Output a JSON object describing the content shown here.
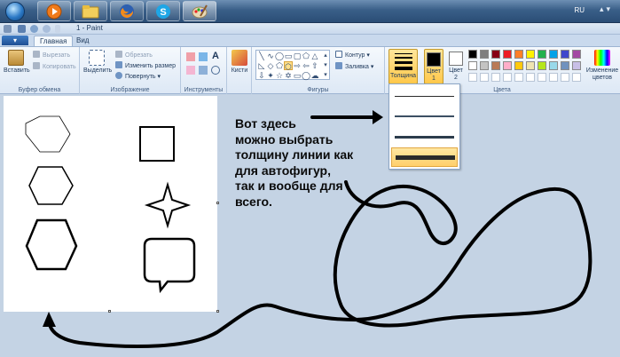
{
  "taskbar": {
    "apps": [
      {
        "name": "start-button"
      },
      {
        "name": "media-player"
      },
      {
        "name": "file-explorer"
      },
      {
        "name": "firefox"
      },
      {
        "name": "skype"
      },
      {
        "name": "paint"
      }
    ],
    "language": "RU"
  },
  "window": {
    "title": "1 - Paint"
  },
  "tabs": {
    "menu": "▾",
    "home": "Главная",
    "view": "Вид"
  },
  "ribbon": {
    "clipboard": {
      "paste": "Вставить",
      "cut": "Вырезать",
      "copy": "Копировать",
      "label": "Буфер обмена"
    },
    "image": {
      "select": "Выделить",
      "crop": "Обрезать",
      "resize": "Изменить размер",
      "rotate": "Повернуть",
      "label": "Изображение"
    },
    "tools": {
      "label": "Инструменты",
      "text_icon": "A"
    },
    "brushes": {
      "label": "Кисти"
    },
    "shapes": {
      "outline": "Контур",
      "fill": "Заливка",
      "label": "Фигуры"
    },
    "size": {
      "label": "Толщина"
    },
    "colors": {
      "color1": "Цвет",
      "color1_num": "1",
      "color2": "Цвет",
      "color2_num": "2",
      "edit": "Изменение цветов",
      "label": "Цвета",
      "palette_row1": [
        "#000000",
        "#7f7f7f",
        "#880015",
        "#ed1c24",
        "#ff7f27",
        "#fff200",
        "#22b14c",
        "#00a2e8",
        "#3f48cc",
        "#a349a4"
      ],
      "palette_row2": [
        "#ffffff",
        "#c3c3c3",
        "#b97a57",
        "#ffaec9",
        "#ffc90e",
        "#efe4b0",
        "#b5e61d",
        "#99d9ea",
        "#7092be",
        "#c8bfe7"
      ],
      "color1_value": "#000000",
      "color2_value": "#ffffff"
    }
  },
  "annotation": {
    "lines": [
      "Вот здесь",
      "можно выбрать",
      "толщину линии как",
      "для автофигур,",
      "так и вообще для",
      "всего."
    ]
  },
  "thickness_options": [
    "1px",
    "3px",
    "5px",
    "8px"
  ],
  "selected_thickness": "8px"
}
